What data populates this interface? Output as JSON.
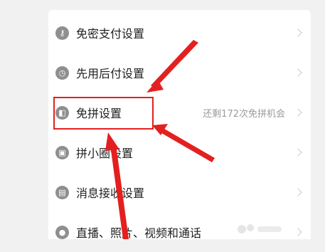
{
  "settings": {
    "items": [
      {
        "label": "免密支付设置",
        "icon": "key-icon"
      },
      {
        "label": "先用后付设置",
        "icon": "clock-pay-icon"
      },
      {
        "label": "免拼设置",
        "icon": "group-icon",
        "extra": "还剩172次免拼机会"
      },
      {
        "label": "拼小圈设置",
        "icon": "lock-icon"
      },
      {
        "label": "消息接收设置",
        "icon": "message-icon"
      },
      {
        "label": "直播、照片、视频和通话",
        "icon": "camera-icon"
      }
    ]
  },
  "colors": {
    "annotation": "#e3201f",
    "label": "#1f1f1f",
    "secondary": "#9a9a9a"
  }
}
